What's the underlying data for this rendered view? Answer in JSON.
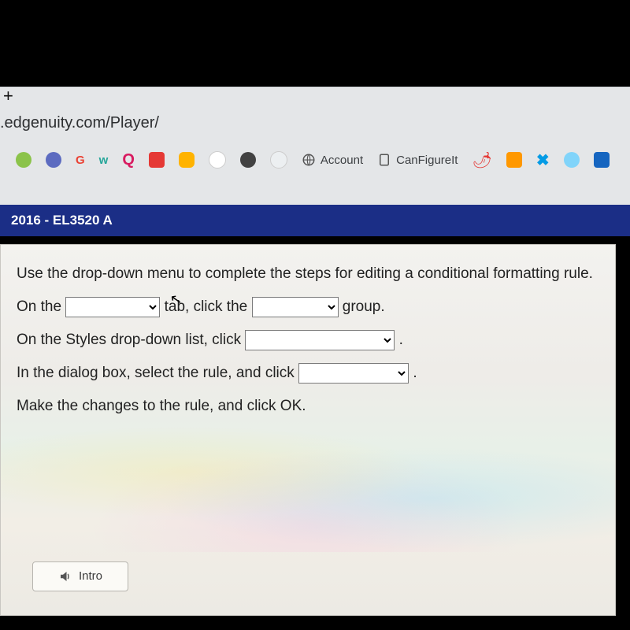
{
  "browser": {
    "plus": "+",
    "address": ".edgenuity.com/Player/",
    "bookmarks": {
      "account": "Account",
      "canfigureit": "CanFigureIt"
    }
  },
  "course": {
    "title": "2016 - EL3520 A"
  },
  "content": {
    "instruction": "Use the drop-down menu to complete the steps for editing a conditional formatting rule.",
    "l1a": "On the ",
    "l1b": " tab, click the ",
    "l1c": " group.",
    "l2a": "On the Styles drop-down list, click ",
    "l2b": ".",
    "l3a": "In the dialog box, select the rule, and click ",
    "l3b": ".",
    "l4": "Make the changes to the rule, and click OK."
  },
  "footer": {
    "intro": "Intro"
  }
}
